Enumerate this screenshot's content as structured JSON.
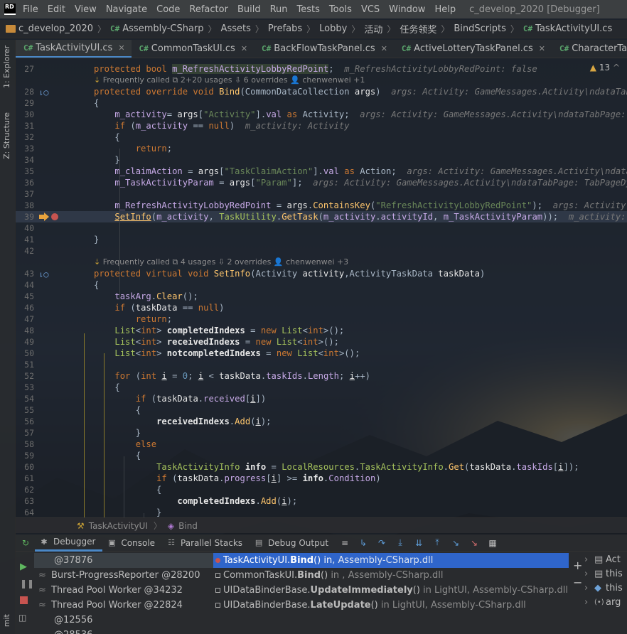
{
  "app_logo": "RD",
  "menu": [
    "File",
    "Edit",
    "View",
    "Navigate",
    "Code",
    "Refactor",
    "Build",
    "Run",
    "Tests",
    "Tools",
    "VCS",
    "Window",
    "Help"
  ],
  "window_title": "c_develop_2020 [Debugger]",
  "breadcrumbs": [
    "c_develop_2020",
    "Assembly-CSharp",
    "Assets",
    "Prefabs",
    "Lobby",
    "活动",
    "任务领奖",
    "BindScripts",
    "TaskActivityUI.cs"
  ],
  "side_tabs": [
    "1: Explorer",
    "Z: Structure",
    "mit"
  ],
  "tabs": [
    "TaskActivityUI.cs",
    "CommonTaskUI.cs",
    "BackFlowTaskPanel.cs",
    "ActiveLotteryTaskPanel.cs",
    "CharacterTaskActivityUI.c"
  ],
  "inspection": {
    "count": "13"
  },
  "hints": {
    "bind": {
      "called": "Frequently called",
      "usages": "2+20 usages",
      "overrides": "6 overrides",
      "author": "chenwenwei +1"
    },
    "setinfo": {
      "called": "Frequently called",
      "usages": "4 usages",
      "overrides": "2 overrides",
      "author": "chenwenwei +3"
    }
  },
  "code_lines": [
    {
      "n": "27",
      "html": "<span class='kw'>protected bool </span><span class='fld' style='background:#344134'>m_RefreshActivityLobbyRedPoint</span>;  <span class='inl'>m_RefreshActivityLobbyRedPoint: false</span>"
    },
    {
      "n": "28",
      "html": "<span class='kw'>protected override void </span><span class='mth'>Bind</span>(CommonDataCollection <span class='loc'>args</span>)  <span class='inl'>args: Activity: GameMessages.Activity\\ndataTabPage</span>"
    },
    {
      "n": "29",
      "html": "{"
    },
    {
      "n": "30",
      "html": "    <span class='fld'>m_activity</span>= <span class='loc'>args</span>[<span class='str'>\"Activity\"</span>].<span class='fld'>val</span> <span class='kw'>as</span> Activity;  <span class='inl'>args: Activity: GameMessages.Activity\\ndataTabPage: TabP</span>"
    },
    {
      "n": "31",
      "html": "    <span class='kw'>if</span> (<span class='fld'>m_activity</span> == <span class='kw'>null</span>)  <span class='inl'>m_activity: Activity</span>"
    },
    {
      "n": "32",
      "html": "    {"
    },
    {
      "n": "33",
      "html": "        <span class='kw'>return</span>;"
    },
    {
      "n": "34",
      "html": "    }"
    },
    {
      "n": "35",
      "html": "    <span class='fld'>m_claimAction</span> = <span class='loc'>args</span>[<span class='str'>\"TaskClaimAction\"</span>].<span class='fld'>val</span> <span class='kw'>as</span> Action;  <span class='inl'>args: Activity: GameMessages.Activity\\ndataTabP</span>"
    },
    {
      "n": "36",
      "html": "    <span class='fld'>m_TaskActivityParam</span> = <span class='loc'>args</span>[<span class='str'>\"Param\"</span>];  <span class='inl'>args: Activity: GameMessages.Activity\\ndataTabPage: TabPageDynami</span>"
    },
    {
      "n": "37",
      "html": ""
    },
    {
      "n": "38",
      "html": "    <span class='fld'>m_RefreshActivityLobbyRedPoint</span> = <span class='loc'>args</span>.<span class='mth'>ContainsKey</span>(<span class='str'>\"RefreshActivityLobbyRedPoint\"</span>);  <span class='inl'>args: Activity: Gam</span>"
    },
    {
      "n": "39",
      "html": "    <span class='mth' style='text-decoration:underline'>SetInfo</span>(<span class='fld'>m_activity</span>, <span class='cls'>TaskUtility</span>.<span class='mth'>GetTask</span>(<span class='fld'>m_activity</span>.<span class='fld'>activityId</span>, <span class='fld'>m_TaskActivityParam</span>));  <span class='inl'>m_activity: Acti</span>"
    },
    {
      "n": "40",
      "html": ""
    },
    {
      "n": "41",
      "html": "}"
    },
    {
      "n": "42",
      "html": ""
    },
    {
      "n": "43",
      "html": "<span class='kw'>protected virtual void </span><span class='mth'>SetInfo</span>(Activity <span class='loc'>activity</span>,ActivityTaskData <span class='loc'>taskData</span>)"
    },
    {
      "n": "44",
      "html": "{"
    },
    {
      "n": "45",
      "html": "    <span class='fld'>taskArg</span>.<span class='mth'>Clear</span>();"
    },
    {
      "n": "46",
      "html": "    <span class='kw'>if</span> (<span class='loc'>taskData</span> == <span class='kw'>null</span>)"
    },
    {
      "n": "47",
      "html": "        <span class='kw'>return</span>;"
    },
    {
      "n": "48",
      "html": "    <span class='typ'>List</span>&lt;<span class='kw'>int</span>&gt; <span class='loc' style='font-weight:bold'>completedIndexs</span> = <span class='kw'>new</span> <span class='typ'>List</span>&lt;<span class='kw'>int</span>&gt;();"
    },
    {
      "n": "49",
      "html": "    <span class='typ'>List</span>&lt;<span class='kw'>int</span>&gt; <span class='loc' style='font-weight:bold'>receivedIndexs</span> = <span class='kw'>new</span> <span class='typ'>List</span>&lt;<span class='kw'>int</span>&gt;();"
    },
    {
      "n": "50",
      "html": "    <span class='typ'>List</span>&lt;<span class='kw'>int</span>&gt; <span class='loc' style='font-weight:bold'>notcompletedIndexs</span> = <span class='kw'>new</span> <span class='typ'>List</span>&lt;<span class='kw'>int</span>&gt;();"
    },
    {
      "n": "51",
      "html": ""
    },
    {
      "n": "52",
      "html": "    <span class='kw'>for</span> (<span class='kw'>int</span> <span class='loc' style='text-decoration:underline'>i</span> = <span class='num-lit'>0</span>; <span class='loc' style='text-decoration:underline'>i</span> &lt; <span class='loc'>taskData</span>.<span class='fld'>taskIds</span>.<span class='fld'>Length</span>; <span class='loc' style='text-decoration:underline'>i</span>++)"
    },
    {
      "n": "53",
      "html": "    {"
    },
    {
      "n": "54",
      "html": "        <span class='kw'>if</span> (<span class='loc'>taskData</span>.<span class='fld'>received</span>[<span class='loc' style='text-decoration:underline'>i</span>])"
    },
    {
      "n": "55",
      "html": "        {"
    },
    {
      "n": "56",
      "html": "            <span class='loc' style='font-weight:bold'>receivedIndexs</span>.<span class='mth'>Add</span>(<span class='loc' style='text-decoration:underline'>i</span>);"
    },
    {
      "n": "57",
      "html": "        }"
    },
    {
      "n": "58",
      "html": "        <span class='kw'>else</span>"
    },
    {
      "n": "59",
      "html": "        {"
    },
    {
      "n": "60",
      "html": "            <span class='typ'>TaskActivityInfo</span> <span class='loc' style='font-weight:bold'>info</span> = <span class='cls'>LocalResources</span>.<span class='cls'>TaskActivityInfo</span>.<span class='mth'>Get</span>(<span class='loc'>taskData</span>.<span class='fld'>taskIds</span>[<span class='loc' style='text-decoration:underline'>i</span>]);"
    },
    {
      "n": "61",
      "html": "            <span class='kw'>if</span> (<span class='loc'>taskData</span>.<span class='fld'>progress</span>[<span class='loc' style='text-decoration:underline'>i</span>] &gt;= <span class='loc' style='font-weight:bold'>info</span>.<span class='fld'>Condition</span>)"
    },
    {
      "n": "62",
      "html": "            {"
    },
    {
      "n": "63",
      "html": "                <span class='loc' style='font-weight:bold'>completedIndexs</span>.<span class='mth'>Add</span>(<span class='loc' style='text-decoration:underline'>i</span>);"
    },
    {
      "n": "64",
      "html": "            }"
    }
  ],
  "nav": {
    "class": "TaskActivityUI",
    "method": "Bind"
  },
  "debug": {
    "tabs": [
      "Debugger",
      "Console",
      "Parallel Stacks",
      "Debug Output"
    ],
    "threads": [
      "@37876",
      "Burst-ProgressReporter @28200",
      "Thread Pool Worker @34232",
      "Thread Pool Worker @22824",
      "@12556",
      "@28536"
    ],
    "frames": [
      {
        "method_class": "TaskActivityUI.",
        "method": "Bind",
        "suffix": "() in",
        "assembly": ", Assembly-CSharp.dll"
      },
      {
        "method_class": "CommonTaskUI.",
        "method": "Bind",
        "suffix": "()",
        "assembly": " in , Assembly-CSharp.dll"
      },
      {
        "method_class": "UIDataBinderBase.",
        "method": "UpdateImmediately",
        "suffix": "()",
        "assembly": " in LightUI, Assembly-CSharp.dll"
      },
      {
        "method_class": "UIDataBinderBase.",
        "method": "LateUpdate",
        "suffix": "()",
        "assembly": " in LightUI, Assembly-CSharp.dll"
      }
    ],
    "vars": [
      "Act",
      "this",
      "this",
      "arg"
    ]
  }
}
